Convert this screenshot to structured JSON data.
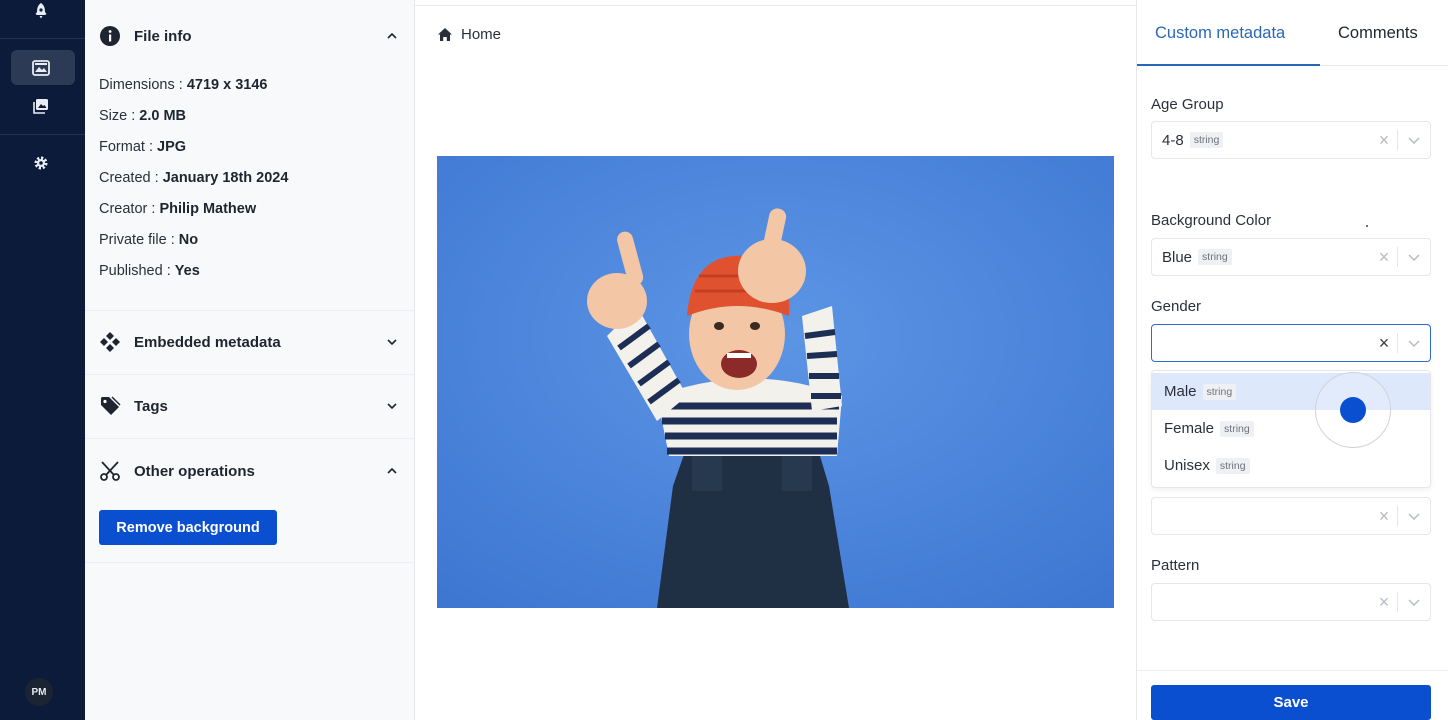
{
  "nav": {
    "items": [
      {
        "icon": "rocket-icon"
      },
      {
        "icon": "image-edit-icon",
        "active": true
      },
      {
        "icon": "gallery-icon"
      },
      {
        "icon": "gear-icon"
      }
    ],
    "avatar_initials": "PM"
  },
  "file_info": {
    "title": "File info",
    "rows": [
      {
        "label": "Dimensions :",
        "value": "4719 x 3146"
      },
      {
        "label": "Size :",
        "value": "2.0 MB"
      },
      {
        "label": "Format :",
        "value": "JPG"
      },
      {
        "label": "Created :",
        "value": "January 18th 2024"
      },
      {
        "label": "Creator :",
        "value": "Philip Mathew"
      },
      {
        "label": "Private file :",
        "value": "No"
      },
      {
        "label": "Published :",
        "value": "Yes"
      }
    ]
  },
  "sections": {
    "embedded": "Embedded metadata",
    "tags": "Tags",
    "other": "Other operations",
    "remove_bg_label": "Remove background"
  },
  "breadcrumb": {
    "home": "Home"
  },
  "tabs": {
    "custom": "Custom metadata",
    "comments": "Comments"
  },
  "fields": {
    "age_group": {
      "label": "Age Group",
      "value": "4-8",
      "type": "string"
    },
    "background_color": {
      "label": "Background Color",
      "value": "Blue",
      "type": "string"
    },
    "gender": {
      "label": "Gender",
      "value": ""
    },
    "pattern": {
      "label": "Pattern",
      "value": ""
    }
  },
  "gender_options": [
    {
      "label": "Male",
      "type": "string"
    },
    {
      "label": "Female",
      "type": "string"
    },
    {
      "label": "Unisex",
      "type": "string"
    }
  ],
  "save_label": "Save",
  "colors": {
    "rail": "#0d1b3a",
    "accent": "#0b4fd1",
    "tab_active": "#2a67b8",
    "photo_bg": "#4a84dc"
  }
}
